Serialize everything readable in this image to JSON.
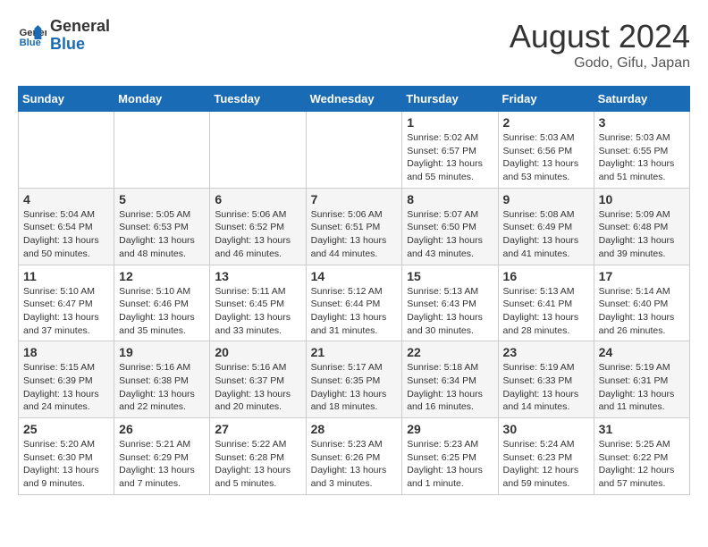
{
  "logo": {
    "line1": "General",
    "line2": "Blue"
  },
  "title": "August 2024",
  "subtitle": "Godo, Gifu, Japan",
  "days_header": [
    "Sunday",
    "Monday",
    "Tuesday",
    "Wednesday",
    "Thursday",
    "Friday",
    "Saturday"
  ],
  "weeks": [
    [
      {
        "day": "",
        "info": ""
      },
      {
        "day": "",
        "info": ""
      },
      {
        "day": "",
        "info": ""
      },
      {
        "day": "",
        "info": ""
      },
      {
        "day": "1",
        "info": "Sunrise: 5:02 AM\nSunset: 6:57 PM\nDaylight: 13 hours\nand 55 minutes."
      },
      {
        "day": "2",
        "info": "Sunrise: 5:03 AM\nSunset: 6:56 PM\nDaylight: 13 hours\nand 53 minutes."
      },
      {
        "day": "3",
        "info": "Sunrise: 5:03 AM\nSunset: 6:55 PM\nDaylight: 13 hours\nand 51 minutes."
      }
    ],
    [
      {
        "day": "4",
        "info": "Sunrise: 5:04 AM\nSunset: 6:54 PM\nDaylight: 13 hours\nand 50 minutes."
      },
      {
        "day": "5",
        "info": "Sunrise: 5:05 AM\nSunset: 6:53 PM\nDaylight: 13 hours\nand 48 minutes."
      },
      {
        "day": "6",
        "info": "Sunrise: 5:06 AM\nSunset: 6:52 PM\nDaylight: 13 hours\nand 46 minutes."
      },
      {
        "day": "7",
        "info": "Sunrise: 5:06 AM\nSunset: 6:51 PM\nDaylight: 13 hours\nand 44 minutes."
      },
      {
        "day": "8",
        "info": "Sunrise: 5:07 AM\nSunset: 6:50 PM\nDaylight: 13 hours\nand 43 minutes."
      },
      {
        "day": "9",
        "info": "Sunrise: 5:08 AM\nSunset: 6:49 PM\nDaylight: 13 hours\nand 41 minutes."
      },
      {
        "day": "10",
        "info": "Sunrise: 5:09 AM\nSunset: 6:48 PM\nDaylight: 13 hours\nand 39 minutes."
      }
    ],
    [
      {
        "day": "11",
        "info": "Sunrise: 5:10 AM\nSunset: 6:47 PM\nDaylight: 13 hours\nand 37 minutes."
      },
      {
        "day": "12",
        "info": "Sunrise: 5:10 AM\nSunset: 6:46 PM\nDaylight: 13 hours\nand 35 minutes."
      },
      {
        "day": "13",
        "info": "Sunrise: 5:11 AM\nSunset: 6:45 PM\nDaylight: 13 hours\nand 33 minutes."
      },
      {
        "day": "14",
        "info": "Sunrise: 5:12 AM\nSunset: 6:44 PM\nDaylight: 13 hours\nand 31 minutes."
      },
      {
        "day": "15",
        "info": "Sunrise: 5:13 AM\nSunset: 6:43 PM\nDaylight: 13 hours\nand 30 minutes."
      },
      {
        "day": "16",
        "info": "Sunrise: 5:13 AM\nSunset: 6:41 PM\nDaylight: 13 hours\nand 28 minutes."
      },
      {
        "day": "17",
        "info": "Sunrise: 5:14 AM\nSunset: 6:40 PM\nDaylight: 13 hours\nand 26 minutes."
      }
    ],
    [
      {
        "day": "18",
        "info": "Sunrise: 5:15 AM\nSunset: 6:39 PM\nDaylight: 13 hours\nand 24 minutes."
      },
      {
        "day": "19",
        "info": "Sunrise: 5:16 AM\nSunset: 6:38 PM\nDaylight: 13 hours\nand 22 minutes."
      },
      {
        "day": "20",
        "info": "Sunrise: 5:16 AM\nSunset: 6:37 PM\nDaylight: 13 hours\nand 20 minutes."
      },
      {
        "day": "21",
        "info": "Sunrise: 5:17 AM\nSunset: 6:35 PM\nDaylight: 13 hours\nand 18 minutes."
      },
      {
        "day": "22",
        "info": "Sunrise: 5:18 AM\nSunset: 6:34 PM\nDaylight: 13 hours\nand 16 minutes."
      },
      {
        "day": "23",
        "info": "Sunrise: 5:19 AM\nSunset: 6:33 PM\nDaylight: 13 hours\nand 14 minutes."
      },
      {
        "day": "24",
        "info": "Sunrise: 5:19 AM\nSunset: 6:31 PM\nDaylight: 13 hours\nand 11 minutes."
      }
    ],
    [
      {
        "day": "25",
        "info": "Sunrise: 5:20 AM\nSunset: 6:30 PM\nDaylight: 13 hours\nand 9 minutes."
      },
      {
        "day": "26",
        "info": "Sunrise: 5:21 AM\nSunset: 6:29 PM\nDaylight: 13 hours\nand 7 minutes."
      },
      {
        "day": "27",
        "info": "Sunrise: 5:22 AM\nSunset: 6:28 PM\nDaylight: 13 hours\nand 5 minutes."
      },
      {
        "day": "28",
        "info": "Sunrise: 5:23 AM\nSunset: 6:26 PM\nDaylight: 13 hours\nand 3 minutes."
      },
      {
        "day": "29",
        "info": "Sunrise: 5:23 AM\nSunset: 6:25 PM\nDaylight: 13 hours\nand 1 minute."
      },
      {
        "day": "30",
        "info": "Sunrise: 5:24 AM\nSunset: 6:23 PM\nDaylight: 12 hours\nand 59 minutes."
      },
      {
        "day": "31",
        "info": "Sunrise: 5:25 AM\nSunset: 6:22 PM\nDaylight: 12 hours\nand 57 minutes."
      }
    ]
  ]
}
